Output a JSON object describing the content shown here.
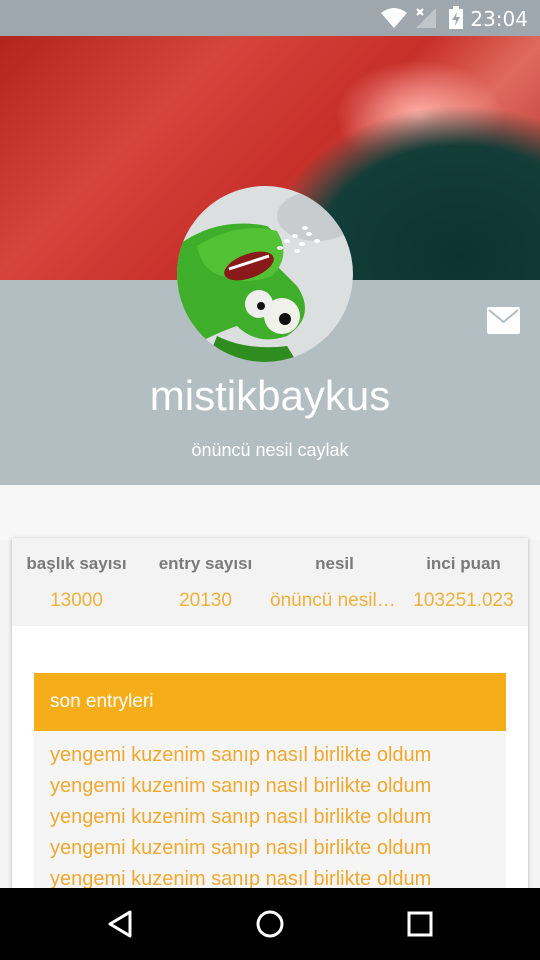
{
  "status_bar": {
    "time": "23:04",
    "icons": [
      "wifi-icon",
      "no-signal-icon",
      "battery-charging-icon"
    ]
  },
  "profile": {
    "username": "mistikbaykus",
    "subtitle": "önüncü nesil caylak",
    "avatar_icon": "kermit-avatar",
    "mail_icon": "mail-icon"
  },
  "stats": [
    {
      "label": "başlık sayısı",
      "value": "13000"
    },
    {
      "label": "entry sayısı",
      "value": "20130"
    },
    {
      "label": "nesil",
      "value": "önüncü nesil caylak"
    },
    {
      "label": "inci puan",
      "value": "103251.023"
    }
  ],
  "recent_entries": {
    "title": "son entryleri",
    "items": [
      "yengemi kuzenim sanıp nasıl birlikte oldum",
      "yengemi kuzenim sanıp nasıl birlikte oldum",
      "yengemi kuzenim sanıp nasıl birlikte oldum",
      "yengemi kuzenim sanıp nasıl birlikte oldum",
      "yengemi kuzenim sanıp nasıl birlikte oldum"
    ]
  },
  "nav_bar": {
    "buttons": [
      "back-icon",
      "home-icon",
      "recents-icon"
    ]
  },
  "colors": {
    "accent": "#f5ad1a",
    "profile_bg": "#b3bec2",
    "link": "#f0a82f"
  }
}
